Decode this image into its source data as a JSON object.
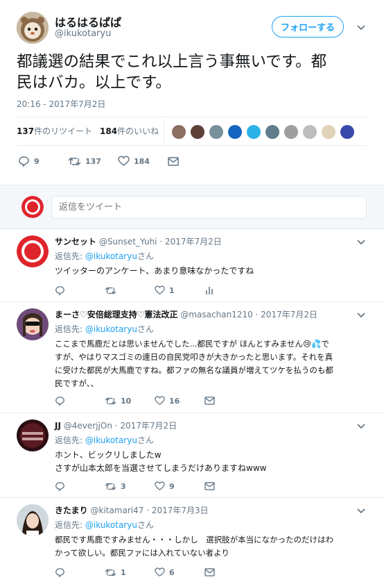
{
  "main_tweet": {
    "name": "はるはるぱぱ",
    "handle": "@ikukotaryu",
    "follow_label": "フォローする",
    "text_line1": "都議選の結果でこれ以上言う事無いです。都",
    "text_line2": "民はバカ。以上です。",
    "timestamp": "20:16 - 2017年7月2日",
    "retweet_count": "137",
    "retweet_label": "件のリツイート",
    "like_count": "184",
    "like_label": "件のいいね",
    "actions": {
      "reply": "9",
      "retweet": "137",
      "like": "184"
    }
  },
  "reply_box": {
    "placeholder": "返信をツイート"
  },
  "replies": [
    {
      "name": "サンセット",
      "handle": "@Sunset_Yuhi",
      "date": "· 2017年7月2日",
      "reply_to_prefix": "返信先: ",
      "reply_to_handle": "@ikukotaryu",
      "reply_to_suffix": "さん",
      "lines": [
        "ツイッターのアンケート、あまり意味なかったですね"
      ],
      "reply_count": "",
      "retweet_count": "",
      "like_count": "1"
    },
    {
      "name": "まーさ♡安倍総理支持♡憲法改正",
      "handle": "@masachan1210",
      "date": "· 2017年7月2日",
      "reply_to_prefix": "返信先: ",
      "reply_to_handle": "@ikukotaryu",
      "reply_to_suffix": "さん",
      "lines": [
        "ここまで馬鹿だとは思いませんでした...都民ですが ほんとすみません😢💦で",
        "すが、やはりマスゴミの連日の自民党叩きが大きかったと思います。それを真",
        "に受けた都民が大馬鹿ですね。都ファの無名な議員が増えてツケを払うのも都",
        "民ですが、、"
      ],
      "reply_count": "",
      "retweet_count": "10",
      "like_count": "16"
    },
    {
      "name": "JJ",
      "handle": "@4everjjOn",
      "date": "· 2017年7月2日",
      "reply_to_prefix": "返信先: ",
      "reply_to_handle": "@ikukotaryu",
      "reply_to_suffix": "さん",
      "lines": [
        "ホント、ビックリしましたw",
        "さすが山本太郎を当選させてしまうだけありますねwww"
      ],
      "reply_count": "",
      "retweet_count": "3",
      "like_count": "9"
    },
    {
      "name": "きたまり",
      "handle": "@kitamari47",
      "date": "· 2017年7月3日",
      "reply_to_prefix": "返信先: ",
      "reply_to_handle": "@ikukotaryu",
      "reply_to_suffix": "さん",
      "lines": [
        "都民です馬鹿ですみません・・・しかし　選択肢が本当になかったのだけはわ",
        "かって欲しい。都民ファには入れていない者より"
      ],
      "reply_count": "",
      "retweet_count": "1",
      "like_count": "6"
    }
  ],
  "colors": {
    "accent": "#1da1f2",
    "muted": "#657786",
    "sunset_red": "#e0242c"
  }
}
